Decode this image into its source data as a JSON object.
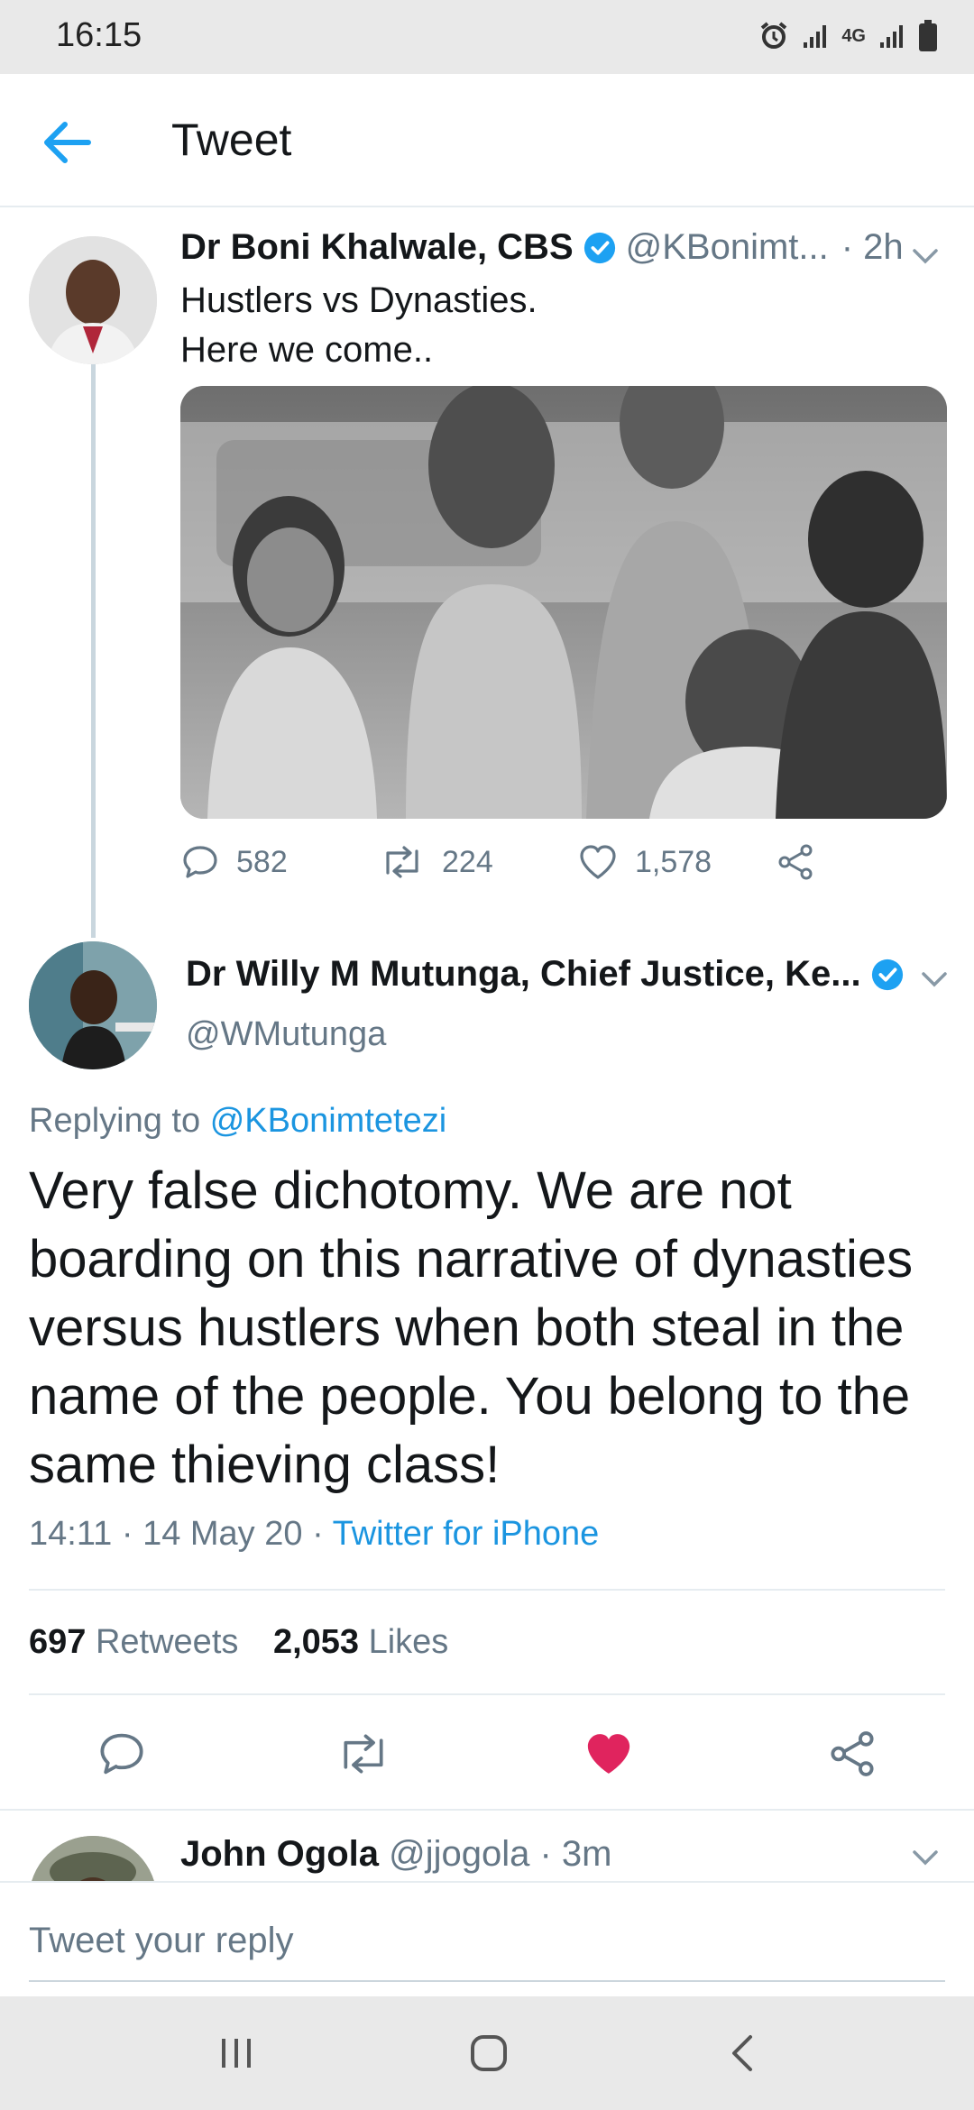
{
  "status_bar": {
    "time": "16:15",
    "network": "4G",
    "icons": [
      "alarm-icon",
      "signal-icon",
      "4g-data-icon",
      "signal-icon",
      "battery-icon"
    ]
  },
  "header": {
    "title": "Tweet",
    "back_icon": "arrow-left-icon"
  },
  "colors": {
    "accent": "#1da1f2",
    "muted": "#657786",
    "like_active": "#e0245e",
    "divider": "#e6ecf0"
  },
  "parent_tweet": {
    "name": "Dr Boni Khalwale, CBS",
    "verified": true,
    "handle": "@KBonimt...",
    "time": "· 2h",
    "text_line1": "Hustlers vs Dynasties.",
    "text_line2": "Here we come..",
    "media": "photo",
    "replies": "582",
    "retweets": "224",
    "likes": "1,578"
  },
  "focal_tweet": {
    "name": "Dr Willy M Mutunga, Chief Justice, Ke...",
    "verified": true,
    "handle": "@WMutunga",
    "replying_prefix": "Replying to",
    "replying_to": "@KBonimtetezi",
    "text": "Very false dichotomy. We are not boarding on this narrative of dynasties versus hustlers when both steal in the name of the people. You belong to the same thieving class!",
    "time": "14:11",
    "date": "14 May 20",
    "source": "Twitter for iPhone",
    "retweet_count": "697",
    "retweet_label": "Retweets",
    "like_count": "2,053",
    "like_label": "Likes",
    "liked": true
  },
  "reply_preview": {
    "name": "John Ogola",
    "handle": "@jjogola",
    "time": "· 3m"
  },
  "composer": {
    "placeholder": "Tweet your reply"
  },
  "nav_bar": {
    "buttons": [
      "recent-apps",
      "home",
      "back"
    ]
  }
}
